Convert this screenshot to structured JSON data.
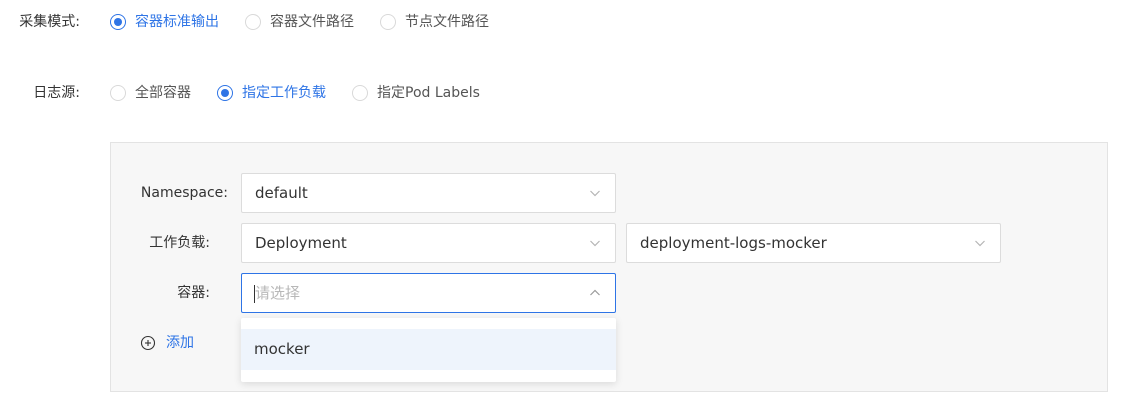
{
  "collect_mode": {
    "label": "采集模式:",
    "options": [
      "容器标准输出",
      "容器文件路径",
      "节点文件路径"
    ],
    "selected": "容器标准输出"
  },
  "log_source": {
    "label": "日志源:",
    "options": [
      "全部容器",
      "指定工作负载",
      "指定Pod Labels"
    ],
    "selected": "指定工作负载"
  },
  "form": {
    "namespace": {
      "label": "Namespace:",
      "value": "default"
    },
    "workload": {
      "label": "工作负载:",
      "type_value": "Deployment",
      "name_value": "deployment-logs-mocker"
    },
    "container": {
      "label": "容器:",
      "placeholder": "请选择",
      "options": [
        "mocker"
      ]
    },
    "add_label": "添加"
  },
  "colors": {
    "accent": "#2e74e6",
    "panel_bg": "#f7f7f7",
    "highlight": "#eef4fc"
  },
  "icons": {
    "dropdown_closed": "chevron-down-icon",
    "dropdown_open": "chevron-up-icon",
    "add": "plus-circle-icon"
  }
}
